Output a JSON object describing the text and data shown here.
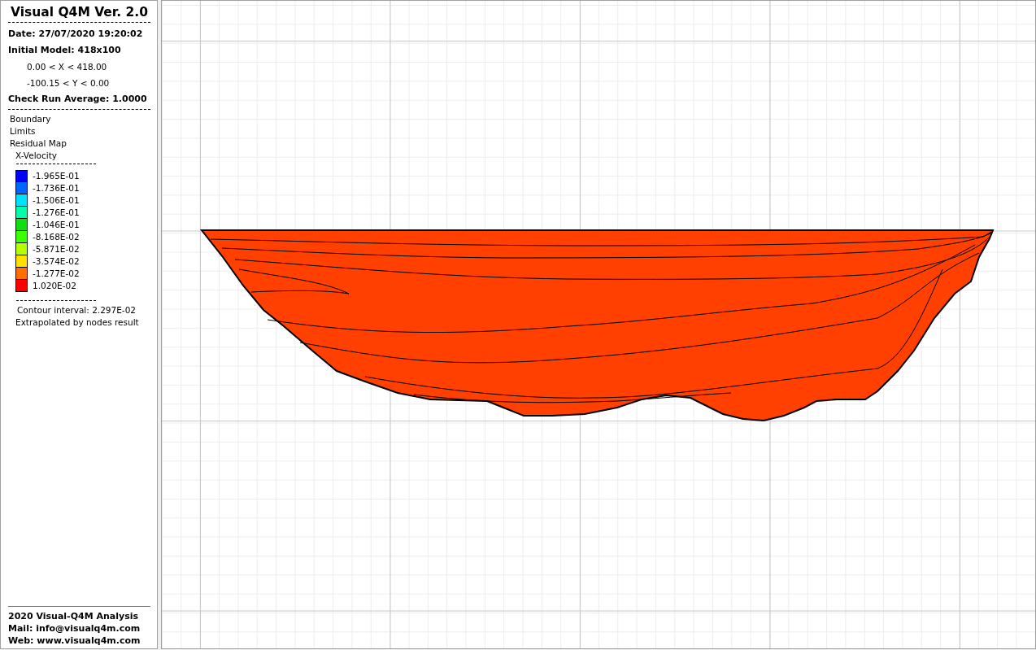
{
  "side_panel": {
    "title": "Visual Q4M Ver. 2.0",
    "date": "Date: 27/07/2020 19:20:02",
    "model": "Initial Model: 418x100",
    "x_range": "0.00 < X < 418.00",
    "y_range": "-100.15 < Y < 0.00",
    "check_run": "Check Run Average: 1.0000",
    "layers": [
      "Boundary",
      "Limits",
      "Residual Map"
    ],
    "variable": "X-Velocity",
    "legend": [
      {
        "label": "-1.965E-01",
        "color": "#0000ff"
      },
      {
        "label": "-1.736E-01",
        "color": "#0066ff"
      },
      {
        "label": "-1.506E-01",
        "color": "#00e0ff"
      },
      {
        "label": "-1.276E-01",
        "color": "#00ffa8"
      },
      {
        "label": "-1.046E-01",
        "color": "#12dd12"
      },
      {
        "label": "-8.168E-02",
        "color": "#3cff00"
      },
      {
        "label": "-5.871E-02",
        "color": "#b4ff00"
      },
      {
        "label": "-3.574E-02",
        "color": "#ffe000"
      },
      {
        "label": "-1.277E-02",
        "color": "#ff7000"
      },
      {
        "label": "1.020E-02",
        "color": "#ff0000"
      }
    ],
    "contour_interval": "Contour interval: 2.297E-02",
    "note": "Extrapolated by nodes result",
    "footer": [
      "2020 Visual-Q4M Analysis",
      "Mail: info@visualq4m.com",
      "Web: www.visualq4m.com"
    ]
  }
}
